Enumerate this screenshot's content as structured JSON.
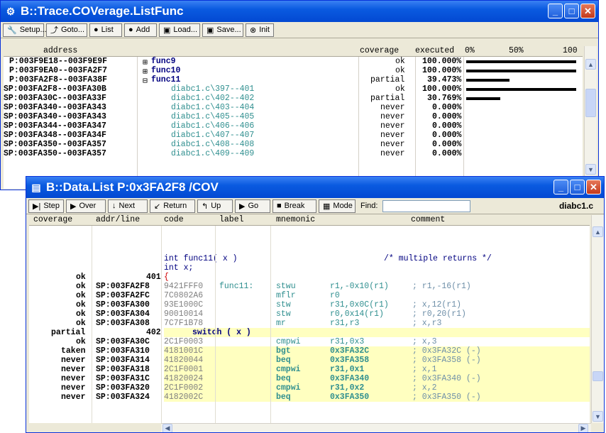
{
  "win1": {
    "title": "B::Trace.COVerage.ListFunc",
    "toolbar": [
      {
        "label": "Setup...",
        "icon": "wrench-icon",
        "glyph": "🔧",
        "w": 58
      },
      {
        "label": "Goto...",
        "icon": "goto-icon",
        "glyph": "⤴",
        "w": 58
      },
      {
        "label": "List",
        "icon": "list-icon",
        "glyph": "●",
        "w": 46
      },
      {
        "label": "Add",
        "icon": "add-icon",
        "glyph": "●",
        "w": 46
      },
      {
        "label": "Load...",
        "icon": "load-icon",
        "glyph": "▣",
        "w": 58
      },
      {
        "label": "Save...",
        "icon": "save-icon",
        "glyph": "▣",
        "w": 58
      },
      {
        "label": "Init",
        "icon": "init-icon",
        "glyph": "⊗",
        "w": 40
      }
    ],
    "headers": {
      "address": "address",
      "coverage": "coverage",
      "executed": "executed",
      "pct0": "0%",
      "pct50": "50%",
      "pct100": "100"
    },
    "rows": [
      {
        "addr": "P:003F9E18--003F9E9F",
        "tree": "⊞",
        "func": "func9",
        "indent": 0,
        "cov": "ok",
        "exec": "100.000%",
        "pct": 1.0
      },
      {
        "addr": "P:003F9EA0--003FA2F7",
        "tree": "⊞",
        "func": "func10",
        "indent": 0,
        "cov": "ok",
        "exec": "100.000%",
        "pct": 1.0
      },
      {
        "addr": "P:003FA2F8--003FA38F",
        "tree": "⊟",
        "func": "func11",
        "indent": 0,
        "cov": "partial",
        "exec": "39.473%",
        "pct": 0.39473
      },
      {
        "addr": "SP:003FA2F8--003FA30B",
        "tree": "",
        "func": "diabc1.c\\397--401",
        "indent": 1,
        "cov": "ok",
        "exec": "100.000%",
        "pct": 1.0
      },
      {
        "addr": "SP:003FA30C--003FA33F",
        "tree": "",
        "func": "diabc1.c\\402--402",
        "indent": 1,
        "cov": "partial",
        "exec": "30.769%",
        "pct": 0.30769
      },
      {
        "addr": "SP:003FA340--003FA343",
        "tree": "",
        "func": "diabc1.c\\403--404",
        "indent": 1,
        "cov": "never",
        "exec": "0.000%",
        "pct": 0
      },
      {
        "addr": "SP:003FA340--003FA343",
        "tree": "",
        "func": "diabc1.c\\405--405",
        "indent": 1,
        "cov": "never",
        "exec": "0.000%",
        "pct": 0
      },
      {
        "addr": "SP:003FA344--003FA347",
        "tree": "",
        "func": "diabc1.c\\406--406",
        "indent": 1,
        "cov": "never",
        "exec": "0.000%",
        "pct": 0
      },
      {
        "addr": "SP:003FA348--003FA34F",
        "tree": "",
        "func": "diabc1.c\\407--407",
        "indent": 1,
        "cov": "never",
        "exec": "0.000%",
        "pct": 0
      },
      {
        "addr": "SP:003FA350--003FA357",
        "tree": "",
        "func": "diabc1.c\\408--408",
        "indent": 1,
        "cov": "never",
        "exec": "0.000%",
        "pct": 0
      },
      {
        "addr": "SP:003FA350--003FA357",
        "tree": "",
        "func": "diabc1.c\\409--409",
        "indent": 1,
        "cov": "never",
        "exec": "0.000%",
        "pct": 0
      }
    ]
  },
  "win2": {
    "title": "B::Data.List P:0x3FA2F8 /COV",
    "toolbar": [
      {
        "label": "Step",
        "icon": "step-icon",
        "glyph": "▶|",
        "w": 50
      },
      {
        "label": "Over",
        "icon": "over-icon",
        "glyph": "▶",
        "w": 56
      },
      {
        "label": "Next",
        "icon": "next-icon",
        "glyph": "↓",
        "w": 56
      },
      {
        "label": "Return",
        "icon": "return-icon",
        "glyph": "↙",
        "w": 64
      },
      {
        "label": "Up",
        "icon": "up-icon",
        "glyph": "↰",
        "w": 50
      },
      {
        "label": "Go",
        "icon": "go-icon",
        "glyph": "▶",
        "w": 50
      },
      {
        "label": "Break",
        "icon": "break-icon",
        "glyph": "■",
        "w": 62
      },
      {
        "label": "Mode",
        "icon": "mode-icon",
        "glyph": "▦",
        "w": 52
      }
    ],
    "find_label": "Find:",
    "find_value": "",
    "file_label": "diabc1.c",
    "headers": {
      "coverage": "coverage",
      "addr": "addr/line",
      "code": "code",
      "label": "label",
      "mnemonic": "mnemonic",
      "comment": "comment"
    },
    "rows": [
      {
        "kind": "blank"
      },
      {
        "kind": "blank"
      },
      {
        "kind": "src",
        "cov": "",
        "line": "",
        "text": "int func11( x )",
        "comment": "/* multiple returns */",
        "hl": false
      },
      {
        "kind": "src",
        "cov": "",
        "line": "",
        "text": "int x;",
        "comment": "",
        "hl": false
      },
      {
        "kind": "src",
        "cov": "ok",
        "line": "401",
        "text": "{",
        "comment": "",
        "hl": false,
        "red": true
      },
      {
        "kind": "asm",
        "cov": "ok",
        "addr": "SP:003FA2F8",
        "code": "9421FFF0",
        "label": "func11:",
        "mn": "stwu",
        "op": "r1,-0x10(r1)",
        "cm": "; r1,-16(r1)",
        "hl": false
      },
      {
        "kind": "asm",
        "cov": "ok",
        "addr": "SP:003FA2FC",
        "code": "7C0802A6",
        "label": "",
        "mn": "mflr",
        "op": "r0",
        "cm": "",
        "hl": false
      },
      {
        "kind": "asm",
        "cov": "ok",
        "addr": "SP:003FA300",
        "code": "93E1000C",
        "label": "",
        "mn": "stw",
        "op": "r31,0x0C(r1)",
        "cm": "; x,12(r1)",
        "hl": false
      },
      {
        "kind": "asm",
        "cov": "ok",
        "addr": "SP:003FA304",
        "code": "90010014",
        "label": "",
        "mn": "stw",
        "op": "r0,0x14(r1)",
        "cm": "; r0,20(r1)",
        "hl": false
      },
      {
        "kind": "asm",
        "cov": "ok",
        "addr": "SP:003FA308",
        "code": "7C7F1B78",
        "label": "",
        "mn": "mr",
        "op": "r31,r3",
        "cm": "; x,r3",
        "hl": false
      },
      {
        "kind": "src",
        "cov": "partial",
        "line": "402",
        "text": "switch ( x )",
        "comment": "",
        "hl": true,
        "indent": true
      },
      {
        "kind": "asm",
        "cov": "ok",
        "addr": "SP:003FA30C",
        "code": "2C1F0003",
        "label": "",
        "mn": "cmpwi",
        "op": "r31,0x3",
        "cm": "; x,3",
        "hl": false
      },
      {
        "kind": "asm",
        "cov": "taken",
        "addr": "SP:003FA310",
        "code": "4181001C",
        "label": "",
        "mn": "bgt",
        "op": "0x3FA32C",
        "cm": "; 0x3FA32C (-)",
        "hl": true,
        "bold": true
      },
      {
        "kind": "asm",
        "cov": "never",
        "addr": "SP:003FA314",
        "code": "41820044",
        "label": "",
        "mn": "beq",
        "op": "0x3FA358",
        "cm": "; 0x3FA358 (-)",
        "hl": true,
        "bold": true
      },
      {
        "kind": "asm",
        "cov": "never",
        "addr": "SP:003FA318",
        "code": "2C1F0001",
        "label": "",
        "mn": "cmpwi",
        "op": "r31,0x1",
        "cm": "; x,1",
        "hl": true,
        "bold": true
      },
      {
        "kind": "asm",
        "cov": "never",
        "addr": "SP:003FA31C",
        "code": "41820024",
        "label": "",
        "mn": "beq",
        "op": "0x3FA340",
        "cm": "; 0x3FA340 (-)",
        "hl": true,
        "bold": true
      },
      {
        "kind": "asm",
        "cov": "never",
        "addr": "SP:003FA320",
        "code": "2C1F0002",
        "label": "",
        "mn": "cmpwi",
        "op": "r31,0x2",
        "cm": "; x,2",
        "hl": true,
        "bold": true
      },
      {
        "kind": "asm",
        "cov": "never",
        "addr": "SP:003FA324",
        "code": "4182002C",
        "label": "",
        "mn": "beq",
        "op": "0x3FA350",
        "cm": "; 0x3FA350 (-)",
        "hl": true,
        "bold": true
      }
    ]
  },
  "colors": {
    "highlight": "#ffffc0",
    "comment": "#6e8fa8",
    "source": "#000080",
    "teal": "#2f8f8f"
  }
}
